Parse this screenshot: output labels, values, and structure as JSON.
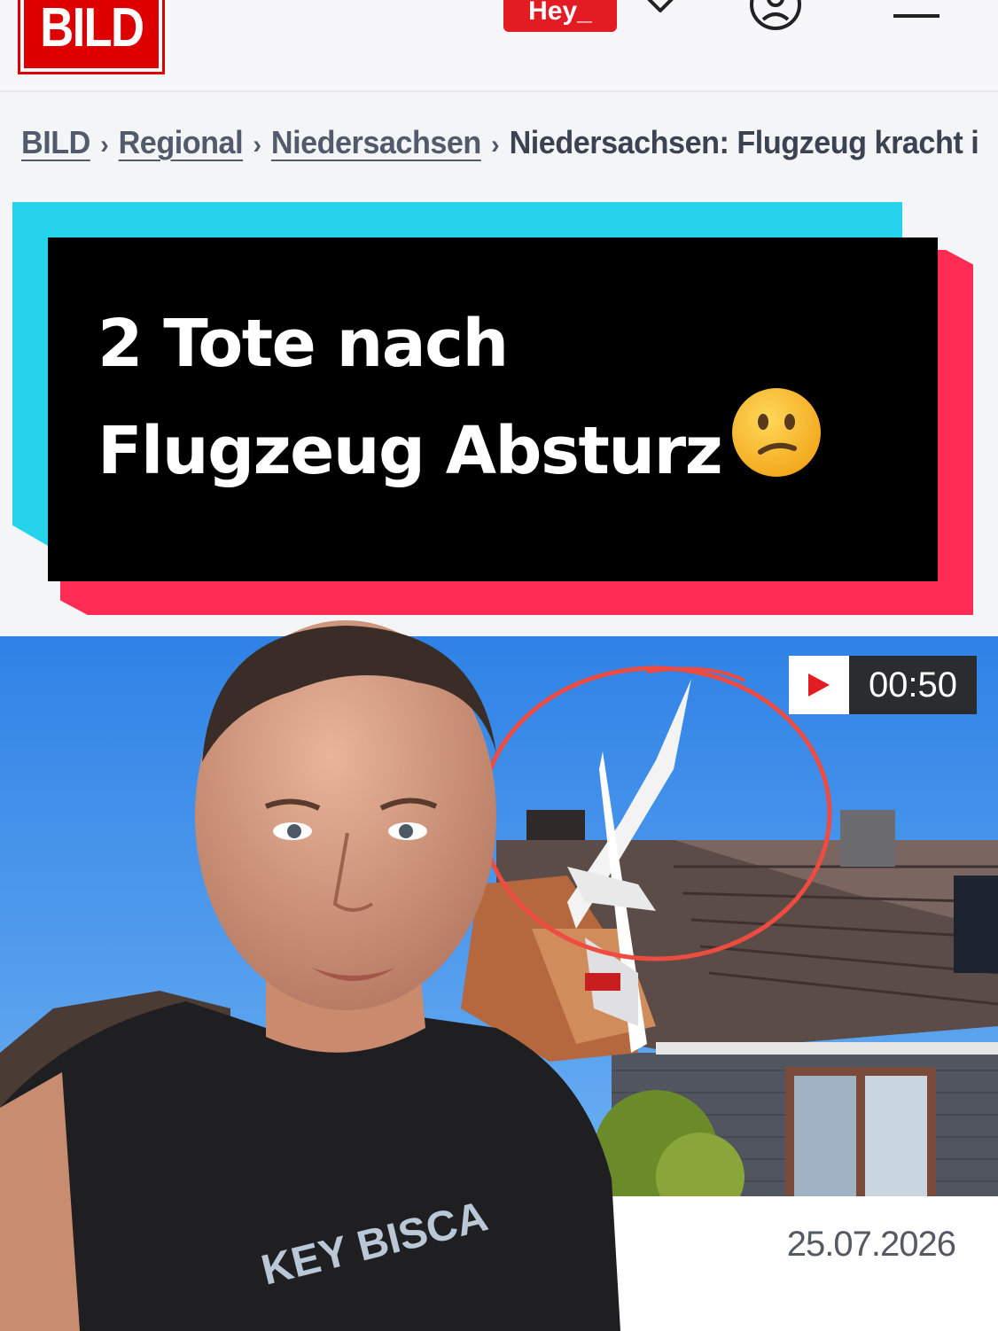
{
  "header": {
    "logo_text": "BILD",
    "hey_label": "Hey_",
    "icons": [
      "heart-icon",
      "account-icon",
      "menu-icon"
    ]
  },
  "breadcrumb": {
    "items": [
      "BILD",
      "Regional",
      "Niedersachsen"
    ],
    "current": "Niedersachsen: Flugzeug kracht i"
  },
  "overlay": {
    "headline_line1": "2 Tote nach",
    "headline_line2": "Flugzeug Absturz",
    "emoji": "confused-face"
  },
  "video": {
    "duration": "00:50",
    "date": "25.07.2026"
  },
  "colors": {
    "bild_red": "#de0000",
    "cyan": "#25d4ec",
    "pink": "#fe2c55",
    "card": "#000000",
    "sky": "#3c8ee8"
  }
}
